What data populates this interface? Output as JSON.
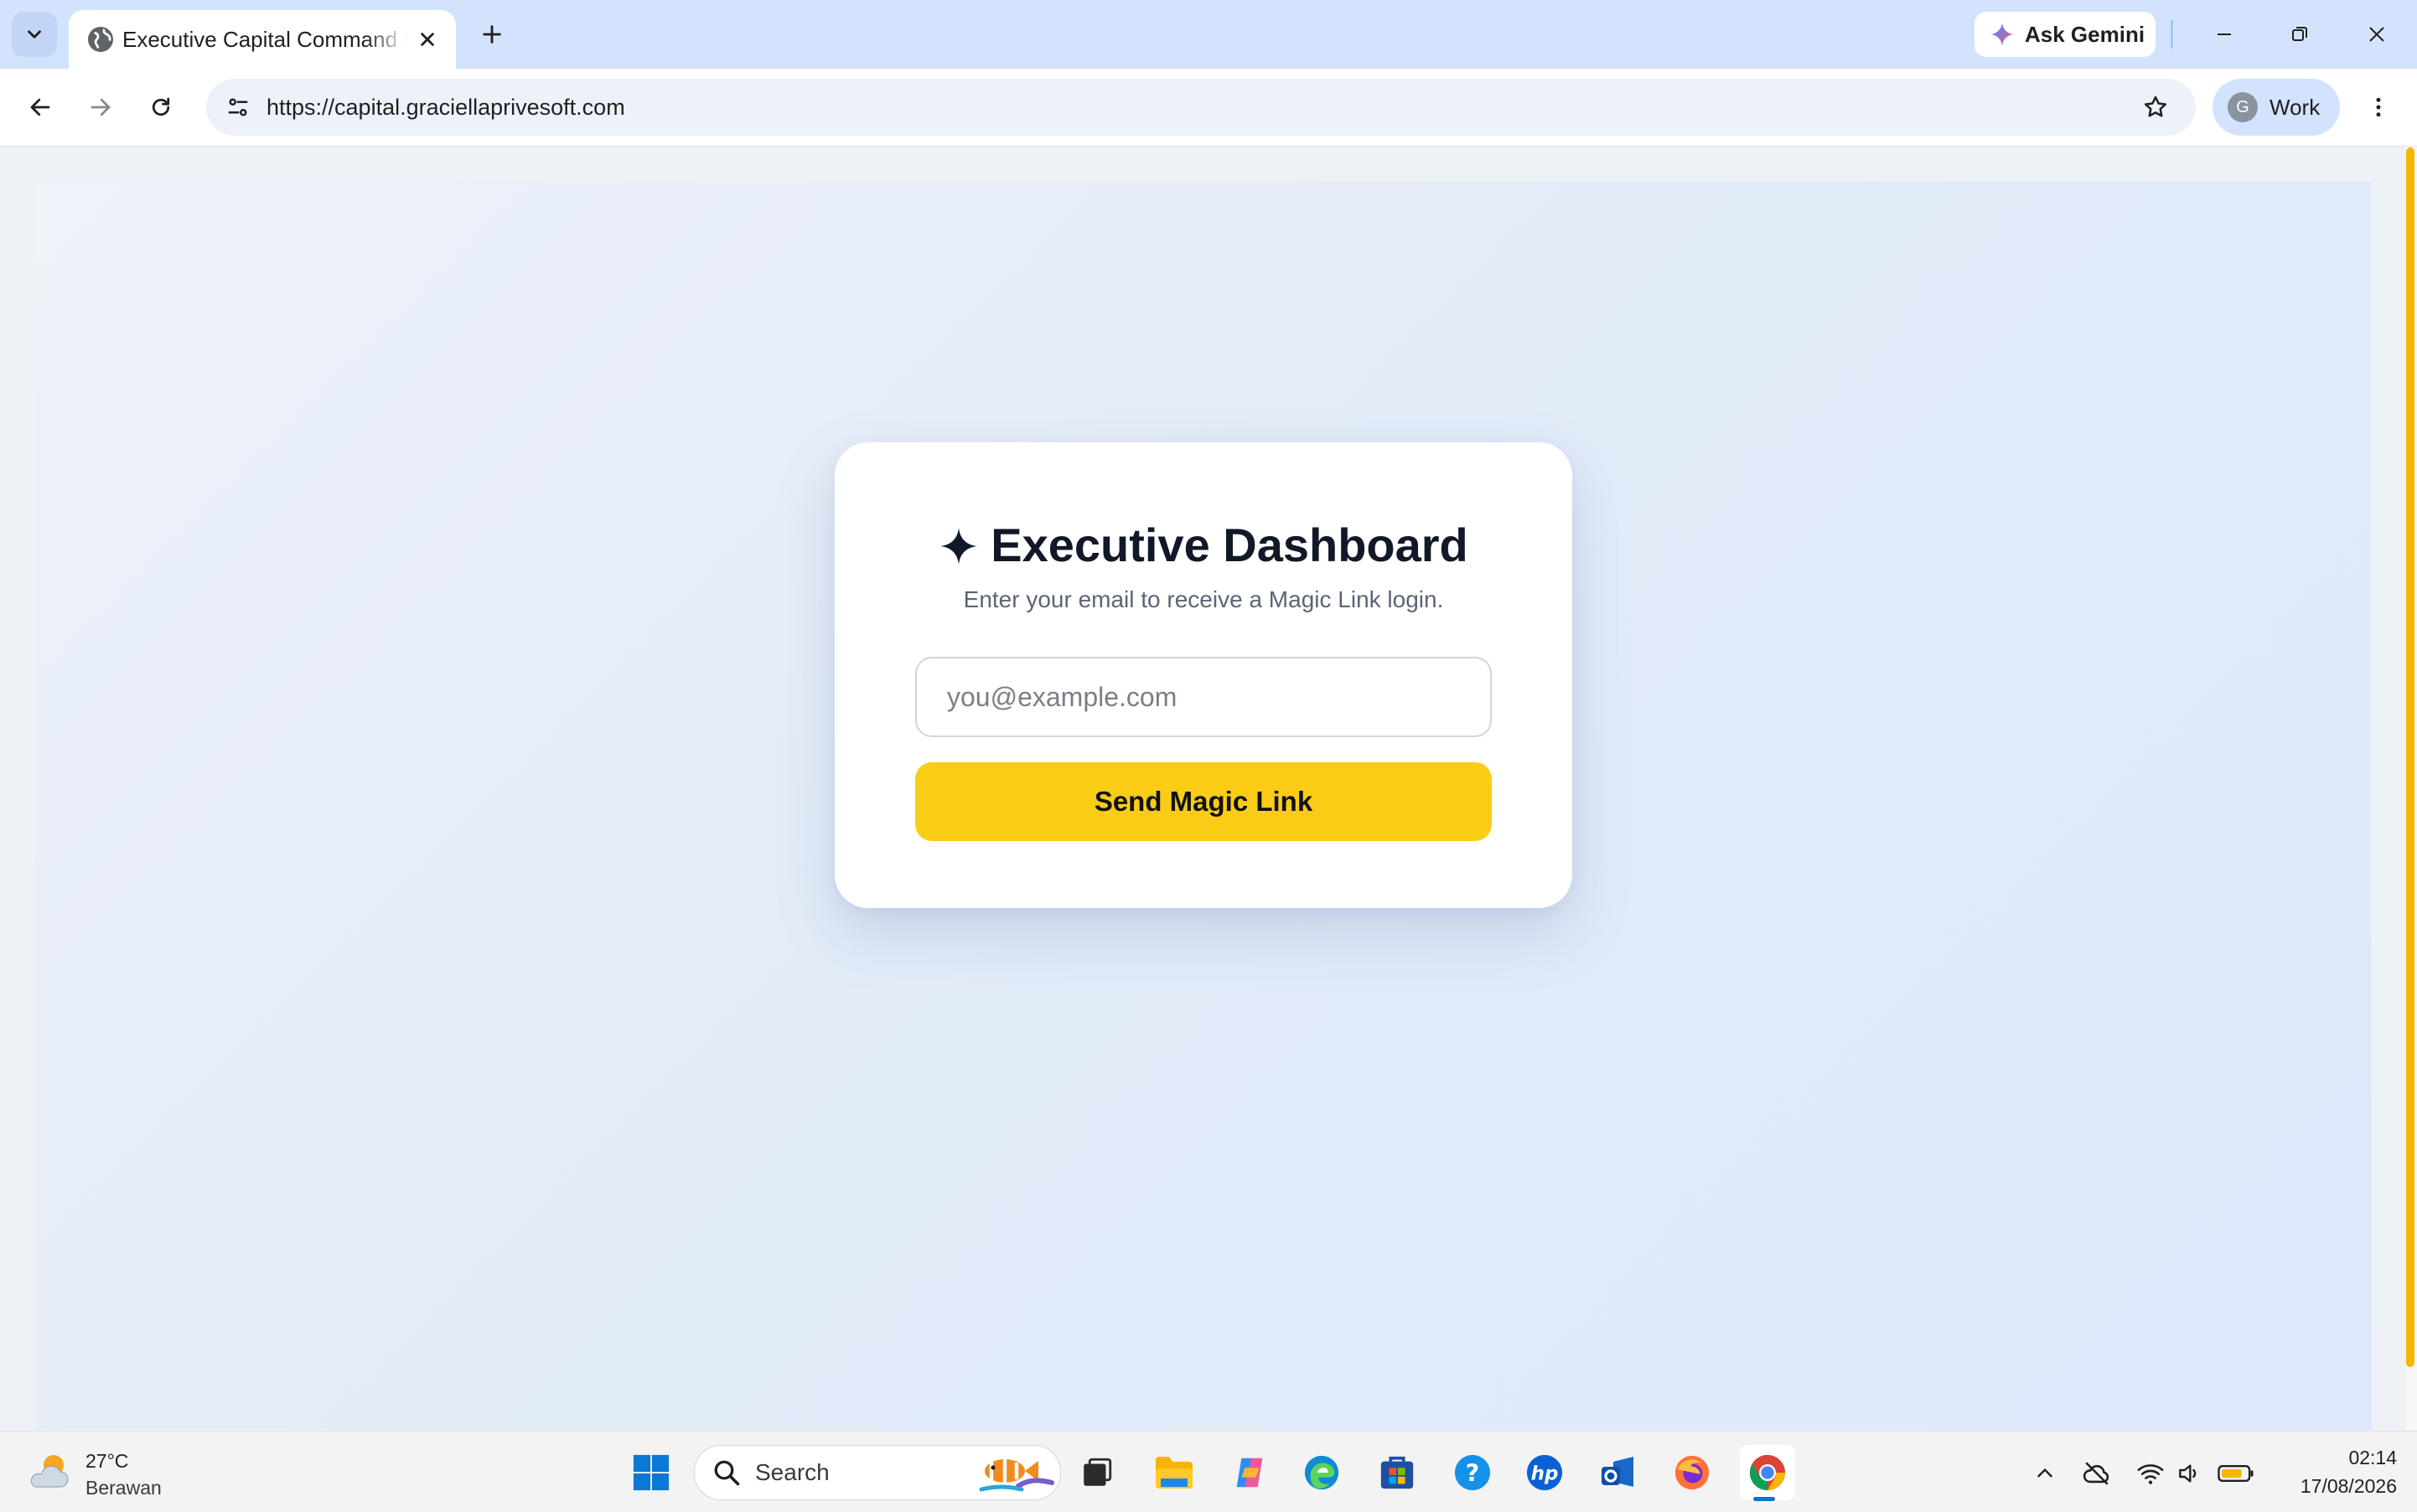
{
  "browser": {
    "tab": {
      "title": "Executive Capital Command Center"
    },
    "ask_gemini_label": "Ask Gemini",
    "url": "https://capital.graciellaprivesoft.com",
    "profile": {
      "initial": "G",
      "name": "Work"
    }
  },
  "login": {
    "title": "Executive Dashboard",
    "subtitle": "Enter your email to receive a Magic Link login.",
    "email_placeholder": "you@example.com",
    "submit_label": "Send Magic Link"
  },
  "taskbar": {
    "weather": {
      "temp": "27°C",
      "condition": "Berawan"
    },
    "search_label": "Search",
    "clock": {
      "time": "02:14",
      "date": "17/08/2026"
    }
  },
  "colors": {
    "accent_yellow": "#facc15",
    "tabstrip": "#d3e3fd",
    "title_text": "#111827"
  }
}
